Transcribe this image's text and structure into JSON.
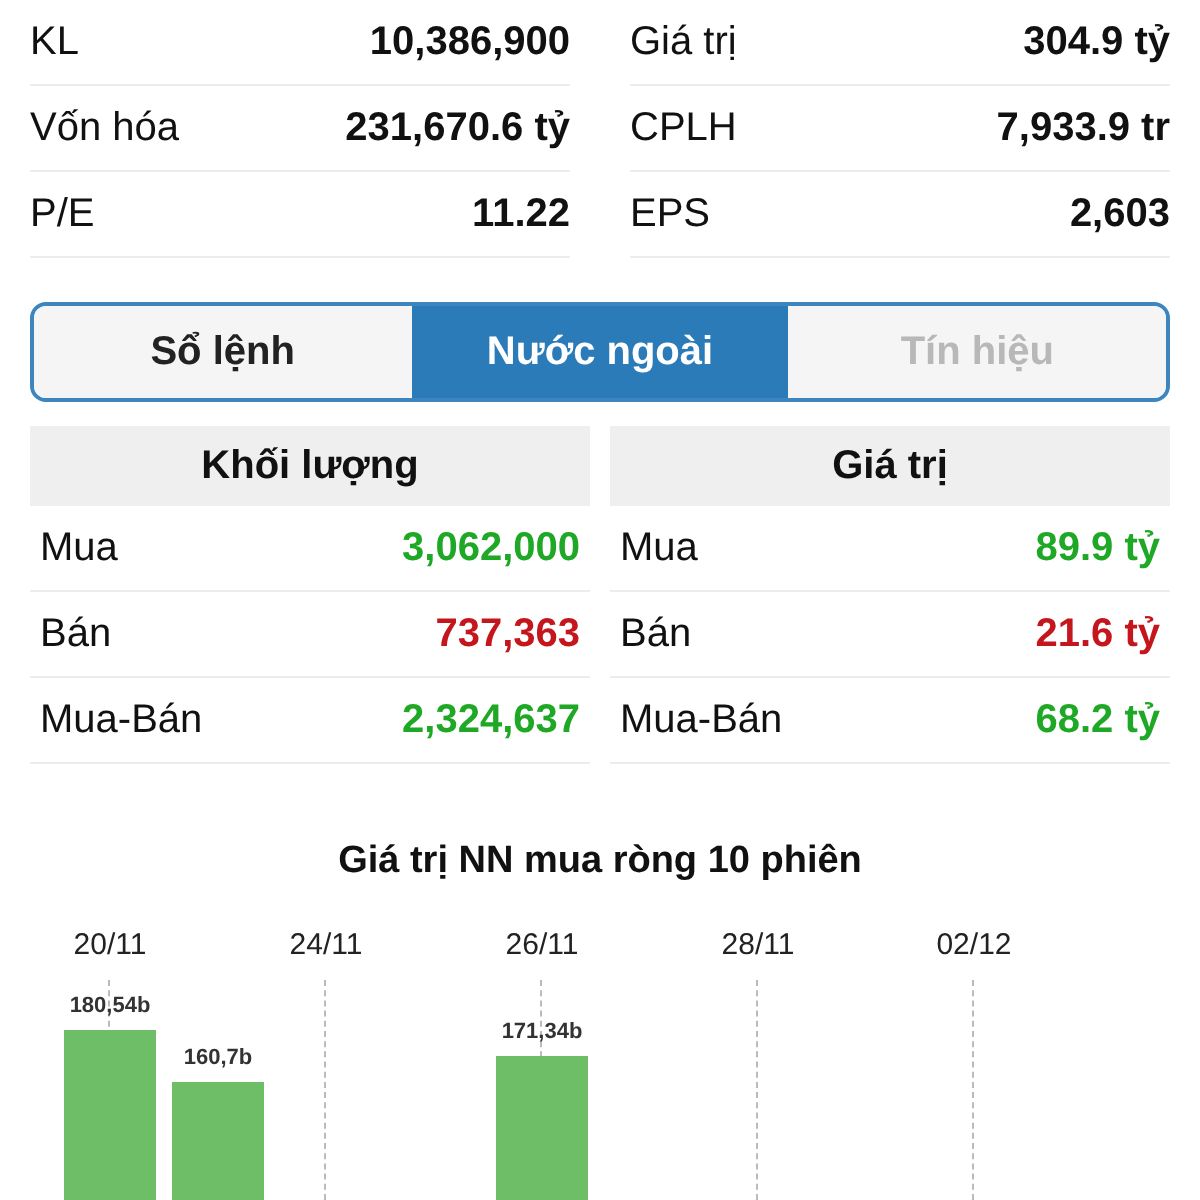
{
  "stats": [
    {
      "left": {
        "label": "KL",
        "value": "10,386,900"
      },
      "right": {
        "label": "Giá trị",
        "value": "304.9 tỷ"
      }
    },
    {
      "left": {
        "label": "Vốn hóa",
        "value": "231,670.6 tỷ"
      },
      "right": {
        "label": "CPLH",
        "value": "7,933.9 tr"
      }
    },
    {
      "left": {
        "label": "P/E",
        "value": "11.22"
      },
      "right": {
        "label": "EPS",
        "value": "2,603"
      }
    }
  ],
  "tabs": [
    {
      "label": "Sổ lệnh",
      "selected": false,
      "disabled": false
    },
    {
      "label": "Nước ngoài",
      "selected": true,
      "disabled": false
    },
    {
      "label": "Tín hiệu",
      "selected": false,
      "disabled": true
    }
  ],
  "foreign": [
    {
      "title": "Khối lượng",
      "rows": [
        {
          "label": "Mua",
          "value": "3,062,000",
          "color": "#1fa826"
        },
        {
          "label": "Bán",
          "value": "737,363",
          "color": "#c4161c"
        },
        {
          "label": "Mua-Bán",
          "value": "2,324,637",
          "color": "#1fa826"
        }
      ]
    },
    {
      "title": "Giá trị",
      "rows": [
        {
          "label": "Mua",
          "value": "89.9 tỷ",
          "color": "#1fa826"
        },
        {
          "label": "Bán",
          "value": "21.6 tỷ",
          "color": "#c4161c"
        },
        {
          "label": "Mua-Bán",
          "value": "68.2 tỷ",
          "color": "#1fa826"
        }
      ]
    }
  ],
  "chart": {
    "title": "Giá trị NN mua ròng 10 phiên",
    "dates": [
      "20/11",
      "24/11",
      "26/11",
      "28/11",
      "02/12"
    ],
    "bar_labels": [
      "180,54b",
      "160,7b",
      "171,34b"
    ]
  }
}
